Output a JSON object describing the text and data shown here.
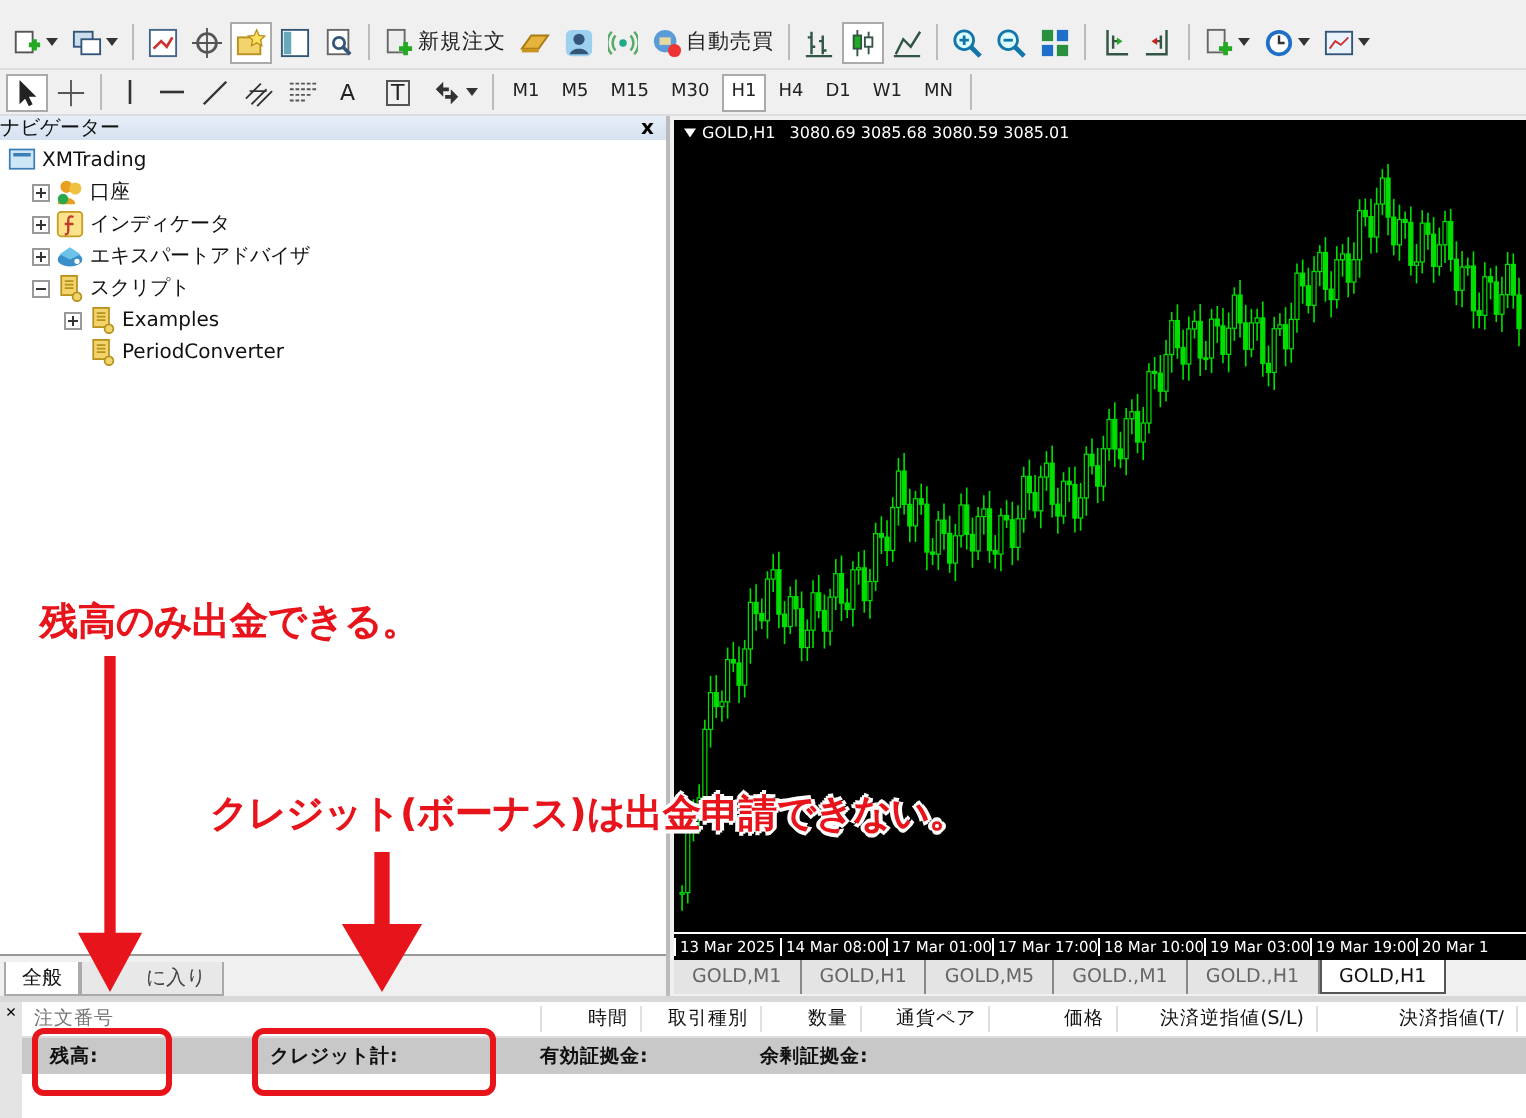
{
  "toolbar": {
    "new_order": "新規注文",
    "auto_trading": "自動売買",
    "navigator_toggle": {
      "selected": true
    },
    "chart_types": [
      {
        "selected": false
      },
      {
        "selected": true
      },
      {
        "selected": false
      }
    ],
    "text_tool": "A",
    "label_tool": "T",
    "timeframes": [
      {
        "label": "M1",
        "selected": false
      },
      {
        "label": "M5",
        "selected": false
      },
      {
        "label": "M15",
        "selected": false
      },
      {
        "label": "M30",
        "selected": false
      },
      {
        "label": "H1",
        "selected": true
      },
      {
        "label": "H4",
        "selected": false
      },
      {
        "label": "D1",
        "selected": false
      },
      {
        "label": "W1",
        "selected": false
      },
      {
        "label": "MN",
        "selected": false
      }
    ]
  },
  "navigator": {
    "title": "ナビゲーター",
    "close": "x",
    "tree": [
      {
        "label": "XMTrading",
        "kind": "terminal",
        "children": [
          {
            "label": "口座",
            "kind": "accounts",
            "expanded": false
          },
          {
            "label": "インディケータ",
            "kind": "indicators",
            "expanded": false
          },
          {
            "label": "エキスパートアドバイザ",
            "kind": "experts",
            "expanded": false
          },
          {
            "label": "スクリプト",
            "kind": "scripts",
            "expanded": true,
            "children": [
              {
                "label": "Examples",
                "kind": "scripts",
                "expanded": false
              },
              {
                "label": "PeriodConverter",
                "kind": "script"
              }
            ]
          }
        ]
      }
    ],
    "tabs": [
      {
        "label": "全般",
        "selected": true
      },
      {
        "label": "に入り",
        "selected": false
      }
    ]
  },
  "chart": {
    "title": "GOLD,H1",
    "ohlc": "3080.69 3085.68 3080.59 3085.01",
    "time_labels": [
      "13 Mar 2025",
      "14 Mar 08:00",
      "17 Mar 01:00",
      "17 Mar 17:00",
      "18 Mar 10:00",
      "19 Mar 03:00",
      "19 Mar 19:00",
      "20 Mar 1"
    ],
    "tabs": [
      {
        "label": "GOLD,M1",
        "selected": false
      },
      {
        "label": "GOLD,H1",
        "selected": false
      },
      {
        "label": "GOLD,M5",
        "selected": false
      },
      {
        "label": "GOLD.,M1",
        "selected": false
      },
      {
        "label": "GOLD.,H1",
        "selected": false
      },
      {
        "label": "GOLD,H1",
        "selected": true
      }
    ]
  },
  "terminal": {
    "close": "×",
    "columns": [
      "注文番号",
      "時間",
      "取引種別",
      "数量",
      "通貨ペア",
      "価格",
      "決済逆指値(S/L)",
      "決済指値(T/"
    ],
    "summary": [
      "残高:",
      "クレジット計:",
      "有効証拠金:",
      "余剰証拠金:"
    ]
  },
  "annotations": [
    {
      "text": "残高のみ出金できる。"
    },
    {
      "text": "クレジット(ボーナス)は出金申請できない。"
    }
  ]
}
